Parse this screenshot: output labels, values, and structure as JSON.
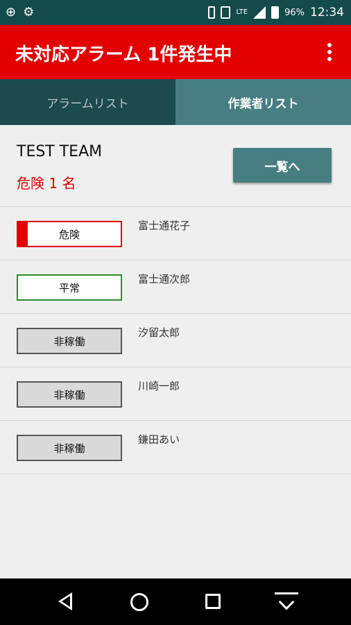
{
  "status_bar": {
    "left_icons": [
      "notification-icon-1",
      "notification-icon-2"
    ],
    "left_glyphs": [
      "⊕",
      "⚙"
    ],
    "network": "LTE",
    "battery": "96%",
    "time": "12:34"
  },
  "header": {
    "title": "未対応アラーム 1件発生中",
    "background": "#e20000"
  },
  "tabs": [
    {
      "label": "アラームリスト",
      "selected": false
    },
    {
      "label": "作業者リスト",
      "selected": true
    }
  ],
  "team": {
    "name": "TEST TEAM",
    "danger_count": "危険 1 名",
    "list_button": "一覧へ"
  },
  "workers": [
    {
      "status": "危険",
      "name": "富士通花子",
      "status_type": "danger",
      "color": "#e20000"
    },
    {
      "status": "平常",
      "name": "富士通次郎",
      "status_type": "normal",
      "color": "#2e8b2e"
    },
    {
      "status": "非稼働",
      "name": "汐留太郎",
      "status_type": "offline",
      "color": "#555555"
    },
    {
      "status": "非稼働",
      "name": "川崎一郎",
      "status_type": "offline",
      "color": "#555555"
    },
    {
      "status": "非稼働",
      "name": "鎌田あい",
      "status_type": "offline",
      "color": "#555555"
    }
  ],
  "colors": {
    "accent_teal": "#477e82",
    "dark_teal": "#1c4a4e",
    "alarm_red": "#e20000"
  }
}
